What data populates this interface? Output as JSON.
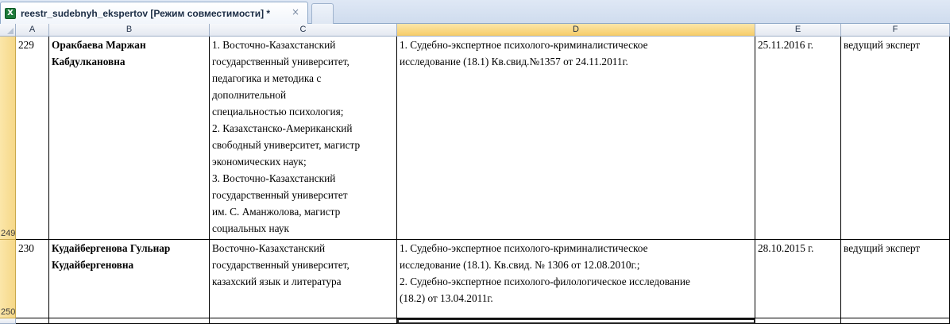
{
  "tab": {
    "title": "reestr_sudebnyh_ekspertov  [Режим совместимости] *",
    "close_glyph": "×",
    "icon": "excel-icon"
  },
  "columns": [
    "A",
    "B",
    "C",
    "D",
    "E",
    "F"
  ],
  "selected_column": "D",
  "rows": [
    {
      "row_number": "249",
      "a": "229",
      "b": [
        "Оракбаева Маржан",
        "Кабдулкановна"
      ],
      "c": [
        "1. Восточно-Казахстанский",
        "государственный университет,",
        "педагогика и методика с",
        "дополнительной",
        "специальностью психология;",
        "2. Казахстанско-Американский",
        "свободный университет, магистр",
        "экономических наук;",
        "3. Восточно-Казахстанский",
        "государственный университет",
        "им. С. Аманжолова, магистр",
        "социальных  наук"
      ],
      "d": [
        "1. Судебно-экспертное психолого-криминалистическое",
        "исследование (18.1) Кв.свид.№1357 от 24.11.2011г."
      ],
      "e": "25.11.2016 г.",
      "f": "ведущий эксперт"
    },
    {
      "row_number": "250",
      "a": "230",
      "b": [
        "Кудайбергенова Гульнар",
        "Кудайбергеновна"
      ],
      "c": [
        "Восточно-Казахстанский",
        "государственный университет,",
        "казахский язык и литература"
      ],
      "d": [
        "1. Судебно-экспертное психолого-криминалистическое",
        "исследование (18.1). Кв.свид. № 1306 от 12.08.2010г.;",
        "2. Судебно-экспертное психолого-филологическое исследование",
        "(18.2) от 13.04.2011г."
      ],
      "e": "28.10.2015 г.",
      "f": "ведущий эксперт"
    }
  ]
}
